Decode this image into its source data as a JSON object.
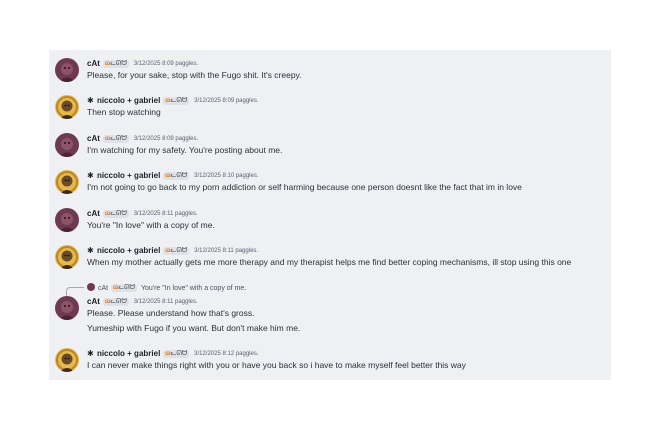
{
  "users": {
    "cat": {
      "name": "cAt",
      "tag_emoji": "ɷ",
      "tag_text": "ᓚᘏᗢ",
      "avatar_color": "#6e3a50"
    },
    "niccolo": {
      "prefix": "✱",
      "name": "niccolo + gabriel",
      "tag_emoji": "ɷ",
      "tag_text": "ᓚᘏᗢ",
      "avatar_color": "#d9a93a"
    }
  },
  "messages": [
    {
      "user": "cat",
      "timestamp": "3/12/2025 8:09 paggles.",
      "text": "Please, for your sake, stop with the Fugo shit. It's creepy."
    },
    {
      "user": "niccolo",
      "timestamp": "3/12/2025 8:09 paggles.",
      "text": "Then stop watching"
    },
    {
      "user": "cat",
      "timestamp": "3/12/2025 8:09 paggles.",
      "text": "I'm watching for my safety. You're posting about me."
    },
    {
      "user": "niccolo",
      "timestamp": "3/12/2025 8:10 paggles.",
      "text": "I'm not going to go back to my porn addiction or self harming because one person doesnt like the fact that im in love"
    },
    {
      "user": "cat",
      "timestamp": "3/12/2025 8:11 paggles.",
      "text": "You're \"In love\" with a copy of me."
    },
    {
      "user": "niccolo",
      "timestamp": "3/12/2025 8:11 paggles.",
      "text": "When my mother actually gets me more therapy and my therapist helps me find better coping mechanisms, ill stop using this one"
    },
    {
      "user": "cat",
      "timestamp": "3/12/2025 8:11 paggles.",
      "text": "Please. Please understand how that's gross.",
      "text2": "Yumeship with Fugo if you want. But don't make him me.",
      "reply": {
        "name": "cAt",
        "tag_emoji": "ɷ",
        "tag_text": "ᓚᘏᗢ",
        "text": "You're \"In love\" with a copy of me."
      }
    },
    {
      "user": "niccolo",
      "timestamp": "3/12/2025 8:12 paggles.",
      "text": "I can never make things right with you or have you back so i have to make myself feel better this way"
    }
  ]
}
